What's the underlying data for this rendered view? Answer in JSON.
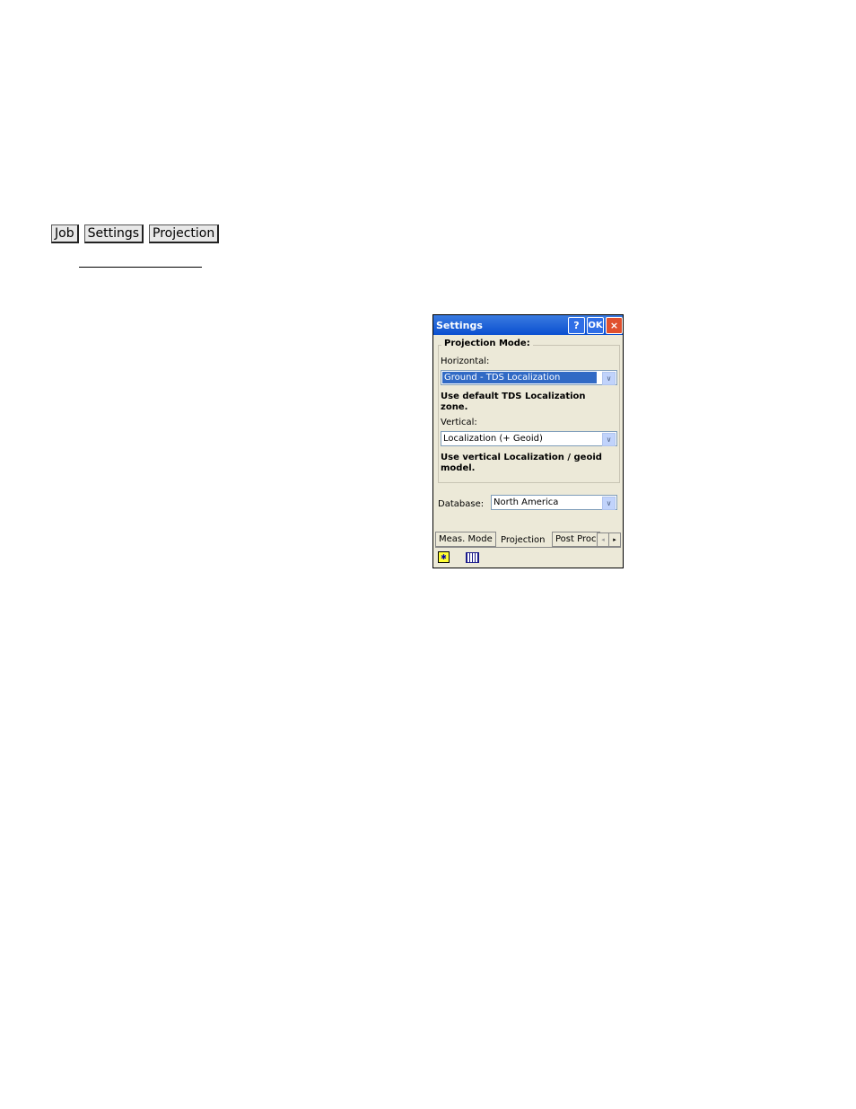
{
  "breadcrumb": [
    "Job",
    "Settings",
    "Projection"
  ],
  "dialog": {
    "title": "Settings",
    "buttons": {
      "help": "?",
      "ok": "OK",
      "close": "×"
    },
    "group_title": "Projection Mode:",
    "horizontal_label": "Horizontal:",
    "horizontal_value": "Ground - TDS Localization",
    "horizontal_desc": "Use default TDS Localization zone.",
    "vertical_label": "Vertical:",
    "vertical_value": "Localization (+ Geoid)",
    "vertical_desc": "Use vertical Localization / geoid model.",
    "database_label": "Database:",
    "database_value": "North America",
    "tabs": [
      "Meas. Mode",
      "Projection",
      "Post Proc"
    ],
    "active_tab": "Projection",
    "scroll_left": "◂",
    "scroll_right": "▸",
    "dropdown_arrow": "∨"
  }
}
